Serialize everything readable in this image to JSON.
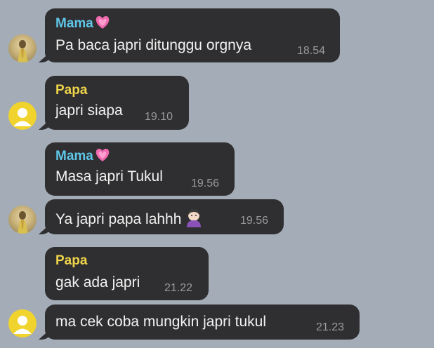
{
  "messages": [
    {
      "sender": "Mama",
      "text": "Pa baca japri ditunggu orgnya",
      "time": "18.54"
    },
    {
      "sender": "Papa",
      "text": "japri siapa",
      "time": "19.10"
    },
    {
      "sender": "Mama",
      "text": "Masa japri Tukul",
      "time": "19.56"
    },
    {
      "sender": "",
      "text": "Ya japri papa lahhh",
      "time": "19.56"
    },
    {
      "sender": "Papa",
      "text": "gak ada japri",
      "time": "21.22"
    },
    {
      "sender": "",
      "text": "ma cek coba mungkin japri tukul",
      "time": "21.23"
    }
  ],
  "colors": {
    "background": "#a4adb7",
    "bubble": "#2f2f31",
    "mama_name": "#5fc6e8",
    "papa_name": "#f0d54a",
    "time": "#9a9a9e"
  },
  "icons": {
    "heart": "pink-heart-icon",
    "emoji": "woman-tipping-hand-icon",
    "mama_avatar": "mama-avatar",
    "papa_avatar": "default-user-avatar"
  }
}
